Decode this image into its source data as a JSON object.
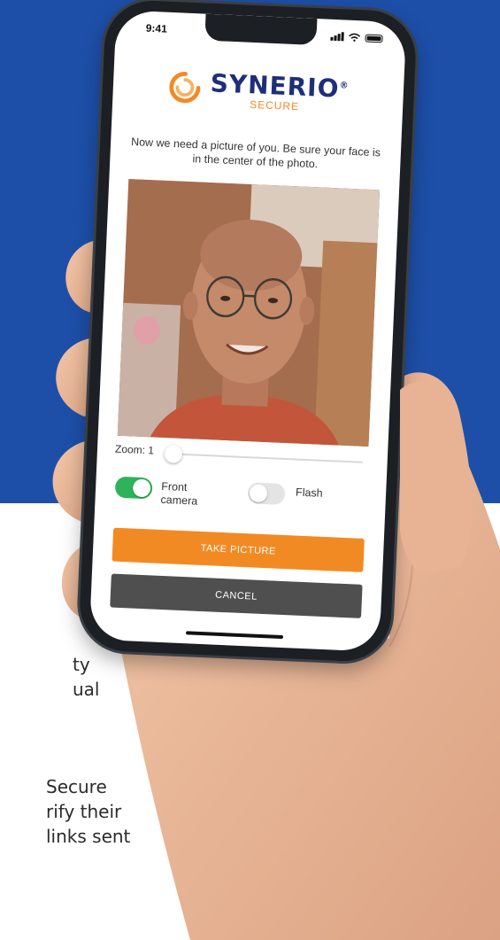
{
  "page": {
    "text_lines": [
      "ty",
      "ual",
      "Secure",
      "rify their",
      "links sent"
    ]
  },
  "status_bar": {
    "time": "9:41"
  },
  "app": {
    "logo_name": "SYNERIO",
    "logo_trademark": "®",
    "logo_sub": "SECURE",
    "instructions": "Now we need a picture of you. Be sure your face is in the center of the photo.",
    "zoom_label": "Zoom: 1",
    "zoom_value": 1,
    "front_camera_label": "Front camera",
    "front_camera_on": true,
    "flash_label": "Flash",
    "flash_on": false,
    "take_picture_label": "TAKE PICTURE",
    "cancel_label": "CANCEL"
  },
  "colors": {
    "background_blue": "#1d4fa8",
    "brand_navy": "#1e2f7a",
    "brand_orange": "#f28a24",
    "toggle_on": "#2eb25a",
    "cancel_gray": "#4f4f4f"
  },
  "icons": [
    "signal-icon",
    "wifi-icon",
    "battery-icon",
    "synerio-logo-icon"
  ]
}
